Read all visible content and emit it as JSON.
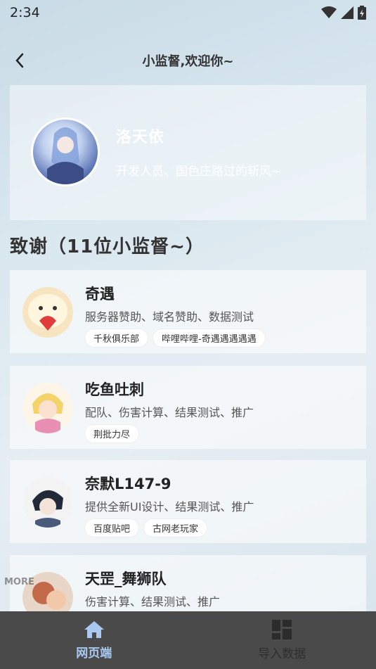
{
  "status_bar": {
    "time": "2:34"
  },
  "header": {
    "title": "小监督,欢迎你~"
  },
  "developer": {
    "name": "洛天依",
    "description": "开发人员、国色庄路过的斩风~"
  },
  "thanks": {
    "title": "致谢（11位小监督~）"
  },
  "supervisors": [
    {
      "name": "奇遇",
      "role": "服务器赞助、域名赞助、数据测试",
      "tags": [
        "千秋俱乐部",
        "哔哩哔哩-奇遇遇遇遇遇"
      ]
    },
    {
      "name": "吃鱼吐刺",
      "role": "配队、伤害计算、结果测试、推广",
      "tags": [
        "荆批力尽"
      ]
    },
    {
      "name": "奈默L147-9",
      "role": "提供全新UI设计、结果测试、推广",
      "tags": [
        "百度贴吧",
        "古网老玩家"
      ]
    },
    {
      "name": "天罡_舞狮队",
      "role": "伤害计算、结果测试、推广",
      "tags": []
    }
  ],
  "bottom_nav": {
    "items": [
      {
        "label": "网页端",
        "icon": "home-icon",
        "active": true
      },
      {
        "label": "导入数据",
        "icon": "dashboard-icon",
        "active": false
      }
    ]
  },
  "watermark": "MORE",
  "colors": {
    "active_tab": "#a9c9f0",
    "nav_bg": "#4a4a4a"
  }
}
